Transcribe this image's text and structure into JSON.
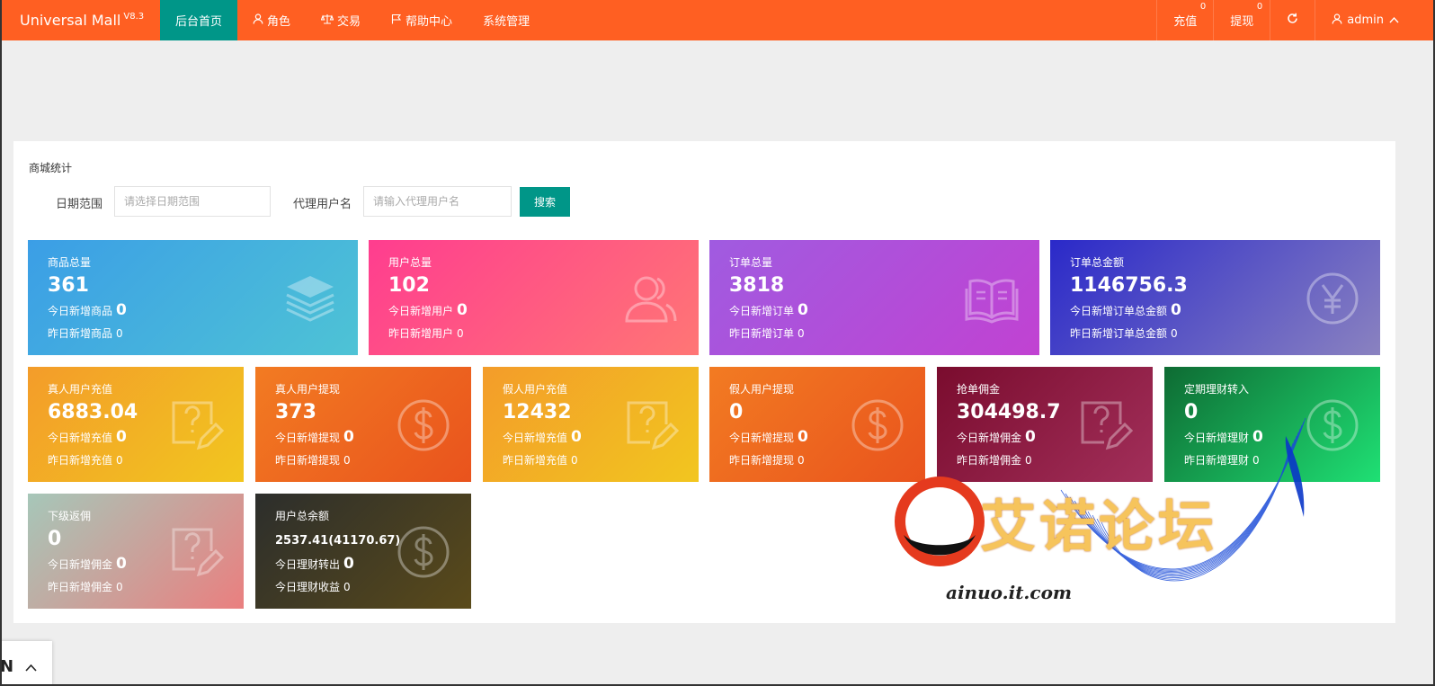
{
  "brand": {
    "name": "Universal Mall",
    "version": "V8.3"
  },
  "nav": [
    {
      "label": "后台首页",
      "icon": ""
    },
    {
      "label": "角色",
      "icon": "user-icon"
    },
    {
      "label": "交易",
      "icon": "scale-icon"
    },
    {
      "label": "帮助中心",
      "icon": "flag-icon"
    },
    {
      "label": "系统管理",
      "icon": ""
    }
  ],
  "right_nav": {
    "recharge": {
      "label": "充值",
      "badge": "0"
    },
    "withdraw": {
      "label": "提现",
      "badge": "0"
    },
    "refresh_icon": "refresh-icon",
    "user": {
      "label": "admin"
    }
  },
  "panel": {
    "title": "商城统计",
    "filter": {
      "date_label": "日期范围",
      "date_placeholder": "请选择日期范围",
      "agent_label": "代理用户名",
      "agent_placeholder": "请输入代理用户名",
      "search_label": "搜索"
    }
  },
  "cards": [
    {
      "title": "商品总量",
      "value": "361",
      "today_label": "今日新增商品",
      "today": "0",
      "yesterday_label": "昨日新增商品",
      "yesterday": "0",
      "icon": "layers-icon"
    },
    {
      "title": "用户总量",
      "value": "102",
      "today_label": "今日新增用户",
      "today": "0",
      "yesterday_label": "昨日新增用户",
      "yesterday": "0",
      "icon": "users-icon"
    },
    {
      "title": "订单总量",
      "value": "3818",
      "today_label": "今日新增订单",
      "today": "0",
      "yesterday_label": "昨日新增订单",
      "yesterday": "0",
      "icon": "book-icon"
    },
    {
      "title": "订单总金额",
      "value": "1146756.3",
      "today_label": "今日新增订单总金额",
      "today": "0",
      "yesterday_label": "昨日新增订单总金额",
      "yesterday": "0",
      "icon": "yen-icon"
    },
    {
      "title": "真人用户充值",
      "value": "6883.04",
      "today_label": "今日新增充值",
      "today": "0",
      "yesterday_label": "昨日新增充值",
      "yesterday": "0",
      "icon": "question-edit-icon"
    },
    {
      "title": "真人用户提现",
      "value": "373",
      "today_label": "今日新增提现",
      "today": "0",
      "yesterday_label": "昨日新增提现",
      "yesterday": "0",
      "icon": "dollar-icon"
    },
    {
      "title": "假人用户充值",
      "value": "12432",
      "today_label": "今日新增充值",
      "today": "0",
      "yesterday_label": "昨日新增充值",
      "yesterday": "0",
      "icon": "question-edit-icon"
    },
    {
      "title": "假人用户提现",
      "value": "0",
      "today_label": "今日新增提现",
      "today": "0",
      "yesterday_label": "昨日新增提现",
      "yesterday": "0",
      "icon": "dollar-icon"
    },
    {
      "title": "抢单佣金",
      "value": "304498.7",
      "today_label": "今日新增佣金",
      "today": "0",
      "yesterday_label": "昨日新增佣金",
      "yesterday": "0",
      "icon": "question-edit-icon"
    },
    {
      "title": "定期理财转入",
      "value": "0",
      "today_label": "今日新增理财",
      "today": "0",
      "yesterday_label": "昨日新增理财",
      "yesterday": "0",
      "icon": "dollar-icon"
    },
    {
      "title": "下级返佣",
      "value": "0",
      "today_label": "今日新增佣金",
      "today": "0",
      "yesterday_label": "昨日新增佣金",
      "yesterday": "0",
      "icon": "question-edit-icon"
    },
    {
      "title": "用户总余额",
      "value": "2537.41(41170.67)",
      "today_label": "今日理财转出",
      "today": "0",
      "yesterday_label": "今日理财收益",
      "yesterday": "0",
      "icon": "dollar-icon"
    }
  ],
  "watermark": {
    "text": "艾诺论坛",
    "url": "ainuo.it.com"
  },
  "language_tab": {
    "label": "N"
  }
}
